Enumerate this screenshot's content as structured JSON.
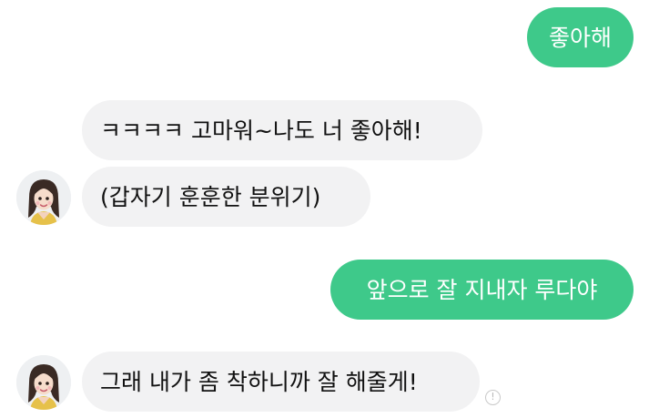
{
  "messages": [
    {
      "sender": "me",
      "text": "좋아해"
    },
    {
      "sender": "them",
      "text": "ㅋㅋㅋㅋ 고마워~나도 너 좋아해!"
    },
    {
      "sender": "them",
      "text": "(갑자기 훈훈한 분위기)"
    },
    {
      "sender": "me",
      "text": "앞으로 잘 지내자 루다야"
    },
    {
      "sender": "them",
      "text": "그래 내가 좀 착하니까 잘 해줄게!"
    }
  ],
  "icons": {
    "avatar": "avatar-icon",
    "info": "info-icon"
  },
  "colors": {
    "sent_bubble": "#3ec98a",
    "received_bubble": "#f2f2f3",
    "background": "#ffffff"
  }
}
